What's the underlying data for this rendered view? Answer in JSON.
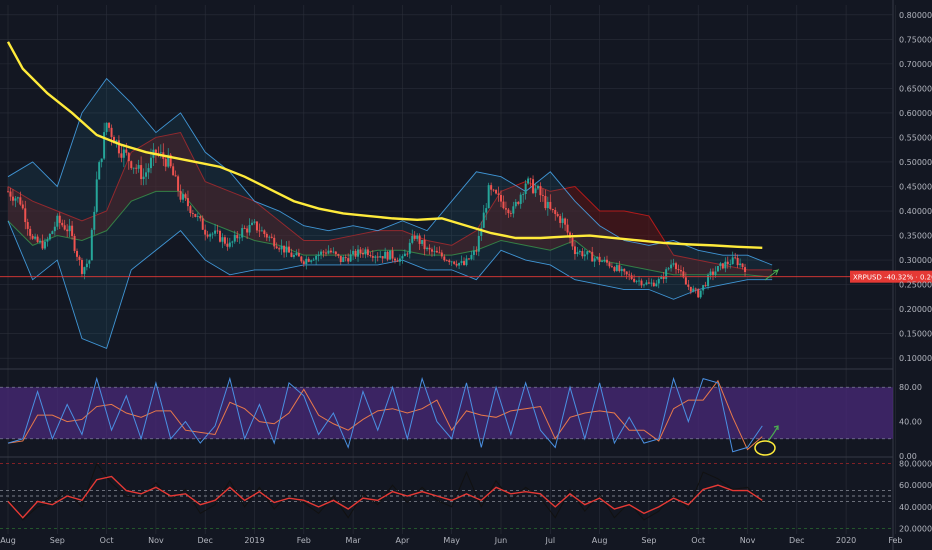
{
  "colors": {
    "background": "#131722",
    "grid": "#2a2e39",
    "axis_text": "#b2b5be",
    "candle_up": "#26a69a",
    "candle_down": "#ef5350",
    "ma200": "#ffeb3b",
    "bb_band": "#4bb3ff",
    "ichimoku_green": "#3a8a3a",
    "ichimoku_red": "#b31b1b",
    "cloud_red_fill": "#5c1414",
    "cloud_green_fill": "#1d4a1d",
    "price_line": "#e53935",
    "price_label_bg": "#e53935",
    "rsi_fill": "#4a2a7a",
    "stoch_k": "#4a90e2",
    "stoch_d": "#e8794a",
    "rsi_line": "#e53935",
    "osc2_line": "#111111",
    "annotation_circle": "#ffeb3b",
    "annotation_arrow": "#4caf50"
  },
  "chart_data": [
    {
      "type": "candlestick",
      "symbol": "XRPUSD",
      "y_axis_ticks": [
        "0.80000",
        "0.75000",
        "0.70000",
        "0.65000",
        "0.60000",
        "0.55000",
        "0.50000",
        "0.45000",
        "0.40000",
        "0.35000",
        "0.30000",
        "0.25000",
        "0.20000",
        "0.15000",
        "0.10000"
      ],
      "ylim": [
        0.08,
        0.82
      ],
      "x_axis_ticks": [
        "Aug",
        "Sep",
        "Oct",
        "Nov",
        "Dec",
        "2019",
        "Feb",
        "Mar",
        "Apr",
        "May",
        "Jun",
        "Jul",
        "Aug",
        "Sep",
        "Oct",
        "Nov",
        "Dec",
        "2020",
        "Feb"
      ],
      "price_label": "XRPUSD -40.32% · 0.26617",
      "last_price": 0.26617,
      "ma200": {
        "x": [
          0,
          0.3,
          0.8,
          1.3,
          1.8,
          2.3,
          2.8,
          3.3,
          3.8,
          4.3,
          4.8,
          5.3,
          5.8,
          6.3,
          6.8,
          7.3,
          7.8,
          8.3,
          8.8,
          9.3,
          9.8,
          10.3,
          10.8,
          11.3,
          11.8,
          12.3,
          12.8,
          13.3,
          13.8,
          14.3,
          14.8,
          15.3
        ],
        "y": [
          0.745,
          0.69,
          0.64,
          0.6,
          0.555,
          0.535,
          0.52,
          0.51,
          0.5,
          0.49,
          0.47,
          0.445,
          0.42,
          0.405,
          0.395,
          0.39,
          0.385,
          0.382,
          0.385,
          0.37,
          0.355,
          0.345,
          0.345,
          0.348,
          0.35,
          0.345,
          0.34,
          0.335,
          0.332,
          0.33,
          0.327,
          0.325
        ]
      },
      "bollinger_upper": {
        "x": [
          0,
          0.5,
          1,
          1.5,
          2,
          2.5,
          3,
          3.5,
          4,
          4.5,
          5,
          5.5,
          6,
          6.5,
          7,
          7.5,
          8,
          8.5,
          9,
          9.5,
          10,
          10.5,
          11,
          11.5,
          12,
          12.5,
          13,
          13.5,
          14,
          14.5,
          15,
          15.5
        ],
        "y": [
          0.47,
          0.5,
          0.45,
          0.6,
          0.67,
          0.62,
          0.56,
          0.6,
          0.52,
          0.48,
          0.42,
          0.4,
          0.37,
          0.36,
          0.37,
          0.36,
          0.38,
          0.36,
          0.42,
          0.48,
          0.47,
          0.44,
          0.48,
          0.42,
          0.37,
          0.34,
          0.33,
          0.34,
          0.32,
          0.31,
          0.31,
          0.29
        ]
      },
      "bollinger_lower": {
        "x": [
          0,
          0.5,
          1,
          1.5,
          2,
          2.5,
          3,
          3.5,
          4,
          4.5,
          5,
          5.5,
          6,
          6.5,
          7,
          7.5,
          8,
          8.5,
          9,
          9.5,
          10,
          10.5,
          11,
          11.5,
          12,
          12.5,
          13,
          13.5,
          14,
          14.5,
          15,
          15.5
        ],
        "y": [
          0.38,
          0.26,
          0.3,
          0.14,
          0.12,
          0.28,
          0.32,
          0.36,
          0.3,
          0.27,
          0.28,
          0.28,
          0.29,
          0.29,
          0.29,
          0.29,
          0.3,
          0.28,
          0.28,
          0.26,
          0.32,
          0.3,
          0.29,
          0.26,
          0.25,
          0.24,
          0.24,
          0.22,
          0.24,
          0.25,
          0.26,
          0.26
        ]
      },
      "ichimoku_cloud_top": {
        "x": [
          0,
          0.5,
          1,
          1.5,
          2,
          2.5,
          3,
          3.5,
          4,
          4.5,
          5,
          5.5,
          6,
          6.5,
          7,
          7.5,
          8,
          8.5,
          9,
          9.5,
          10,
          10.5,
          11,
          11.5,
          12,
          12.5,
          13,
          13.5,
          14,
          14.5,
          15,
          15.5
        ],
        "y": [
          0.45,
          0.42,
          0.4,
          0.38,
          0.4,
          0.52,
          0.55,
          0.56,
          0.46,
          0.44,
          0.42,
          0.38,
          0.34,
          0.34,
          0.35,
          0.36,
          0.36,
          0.34,
          0.33,
          0.36,
          0.44,
          0.46,
          0.44,
          0.45,
          0.4,
          0.4,
          0.39,
          0.31,
          0.3,
          0.29,
          0.28,
          0.28
        ]
      },
      "ichimoku_cloud_bottom": {
        "x": [
          0,
          0.5,
          1,
          1.5,
          2,
          2.5,
          3,
          3.5,
          4,
          4.5,
          5,
          5.5,
          6,
          6.5,
          7,
          7.5,
          8,
          8.5,
          9,
          9.5,
          10,
          10.5,
          11,
          11.5,
          12,
          12.5,
          13,
          13.5,
          14,
          14.5,
          15,
          15.5
        ],
        "y": [
          0.38,
          0.33,
          0.35,
          0.34,
          0.36,
          0.42,
          0.44,
          0.44,
          0.38,
          0.36,
          0.34,
          0.33,
          0.31,
          0.31,
          0.31,
          0.32,
          0.32,
          0.31,
          0.31,
          0.32,
          0.34,
          0.33,
          0.32,
          0.34,
          0.3,
          0.29,
          0.28,
          0.27,
          0.27,
          0.27,
          0.27,
          0.265
        ]
      },
      "close_path": {
        "x": [
          0,
          0.25,
          0.5,
          0.75,
          1,
          1.25,
          1.5,
          1.65,
          1.8,
          2,
          2.25,
          2.5,
          2.75,
          3,
          3.25,
          3.5,
          3.75,
          4,
          4.25,
          4.5,
          4.75,
          5,
          5.25,
          5.5,
          5.75,
          6,
          6.25,
          6.5,
          6.75,
          7,
          7.25,
          7.5,
          7.75,
          8,
          8.25,
          8.5,
          8.75,
          9,
          9.25,
          9.5,
          9.75,
          10,
          10.25,
          10.5,
          10.75,
          11,
          11.25,
          11.5,
          11.75,
          12,
          12.25,
          12.5,
          12.75,
          13,
          13.25,
          13.5,
          13.75,
          14,
          14.25,
          14.5,
          14.75,
          15
        ],
        "y": [
          0.44,
          0.42,
          0.34,
          0.33,
          0.38,
          0.36,
          0.28,
          0.3,
          0.46,
          0.58,
          0.53,
          0.5,
          0.47,
          0.52,
          0.5,
          0.43,
          0.4,
          0.36,
          0.35,
          0.33,
          0.36,
          0.37,
          0.35,
          0.33,
          0.31,
          0.3,
          0.31,
          0.32,
          0.3,
          0.31,
          0.32,
          0.31,
          0.31,
          0.3,
          0.35,
          0.32,
          0.31,
          0.3,
          0.29,
          0.32,
          0.44,
          0.42,
          0.4,
          0.46,
          0.44,
          0.4,
          0.38,
          0.32,
          0.31,
          0.3,
          0.29,
          0.27,
          0.26,
          0.25,
          0.26,
          0.3,
          0.25,
          0.23,
          0.27,
          0.29,
          0.3,
          0.28
        ]
      }
    },
    {
      "type": "line",
      "name": "stochastic_rsi",
      "y_axis_ticks": [
        "80.00",
        "40.00",
        "0.00"
      ],
      "ylim": [
        0,
        100
      ],
      "overbought": 80,
      "oversold": 20,
      "k": {
        "x": [
          0,
          0.3,
          0.6,
          0.9,
          1.2,
          1.5,
          1.8,
          2.1,
          2.4,
          2.7,
          3.0,
          3.3,
          3.6,
          3.9,
          4.2,
          4.5,
          4.8,
          5.1,
          5.4,
          5.7,
          6.0,
          6.3,
          6.6,
          6.9,
          7.2,
          7.5,
          7.8,
          8.1,
          8.4,
          8.7,
          9.0,
          9.3,
          9.6,
          9.9,
          10.2,
          10.5,
          10.8,
          11.1,
          11.4,
          11.7,
          12.0,
          12.3,
          12.6,
          12.9,
          13.2,
          13.5,
          13.8,
          14.1,
          14.4,
          14.7,
          15.0,
          15.3
        ],
        "y": [
          15,
          20,
          75,
          20,
          60,
          25,
          90,
          30,
          70,
          20,
          85,
          20,
          40,
          15,
          35,
          90,
          20,
          60,
          15,
          85,
          70,
          25,
          50,
          10,
          75,
          30,
          80,
          20,
          90,
          40,
          20,
          85,
          10,
          80,
          25,
          85,
          30,
          10,
          80,
          20,
          85,
          15,
          45,
          15,
          20,
          90,
          40,
          90,
          85,
          5,
          10,
          35
        ]
      }
    },
    {
      "type": "line",
      "name": "rsi",
      "y_axis_ticks": [
        "80.00000",
        "60.00000",
        "40.00000",
        "20.00000"
      ],
      "ylim": [
        15,
        85
      ],
      "levels": [
        80,
        55,
        50,
        45,
        20
      ],
      "rsi": {
        "x": [
          0,
          0.3,
          0.6,
          0.9,
          1.2,
          1.5,
          1.8,
          2.1,
          2.4,
          2.7,
          3.0,
          3.3,
          3.6,
          3.9,
          4.2,
          4.5,
          4.8,
          5.1,
          5.4,
          5.7,
          6.0,
          6.3,
          6.6,
          6.9,
          7.2,
          7.5,
          7.8,
          8.1,
          8.4,
          8.7,
          9.0,
          9.3,
          9.6,
          9.9,
          10.2,
          10.5,
          10.8,
          11.1,
          11.4,
          11.7,
          12.0,
          12.3,
          12.6,
          12.9,
          13.2,
          13.5,
          13.8,
          14.1,
          14.4,
          14.7,
          15.0,
          15.3
        ],
        "y": [
          45,
          30,
          45,
          42,
          50,
          46,
          65,
          68,
          55,
          52,
          58,
          50,
          52,
          42,
          46,
          58,
          46,
          54,
          44,
          48,
          46,
          40,
          46,
          38,
          48,
          46,
          54,
          50,
          54,
          50,
          46,
          52,
          46,
          58,
          52,
          54,
          52,
          40,
          52,
          42,
          48,
          38,
          42,
          34,
          40,
          48,
          42,
          56,
          60,
          55,
          55,
          46
        ]
      },
      "osc2": {
        "x": [
          0,
          0.3,
          0.6,
          0.9,
          1.2,
          1.5,
          1.8,
          2.1,
          2.4,
          2.7,
          3.0,
          3.3,
          3.6,
          3.9,
          4.2,
          4.5,
          4.8,
          5.1,
          5.4,
          5.7,
          6.0,
          6.3,
          6.6,
          6.9,
          7.2,
          7.5,
          7.8,
          8.1,
          8.4,
          8.7,
          9.0,
          9.3,
          9.6,
          9.9,
          10.2,
          10.5,
          10.8,
          11.1,
          11.4,
          11.7,
          12.0,
          12.3,
          12.6,
          12.9,
          13.2,
          13.5,
          13.8,
          14.1,
          14.4,
          14.7,
          15.0,
          15.3
        ],
        "y": [
          48,
          28,
          40,
          44,
          55,
          40,
          80,
          62,
          50,
          48,
          62,
          46,
          56,
          34,
          42,
          64,
          40,
          58,
          38,
          52,
          44,
          34,
          50,
          30,
          52,
          42,
          60,
          44,
          58,
          46,
          40,
          72,
          40,
          64,
          46,
          58,
          48,
          30,
          56,
          36,
          52,
          30,
          44,
          28,
          36,
          52,
          38,
          72,
          66,
          56,
          58,
          44
        ]
      }
    }
  ],
  "annotations": {
    "oversold_circle_label": "",
    "arrow_label": ""
  }
}
